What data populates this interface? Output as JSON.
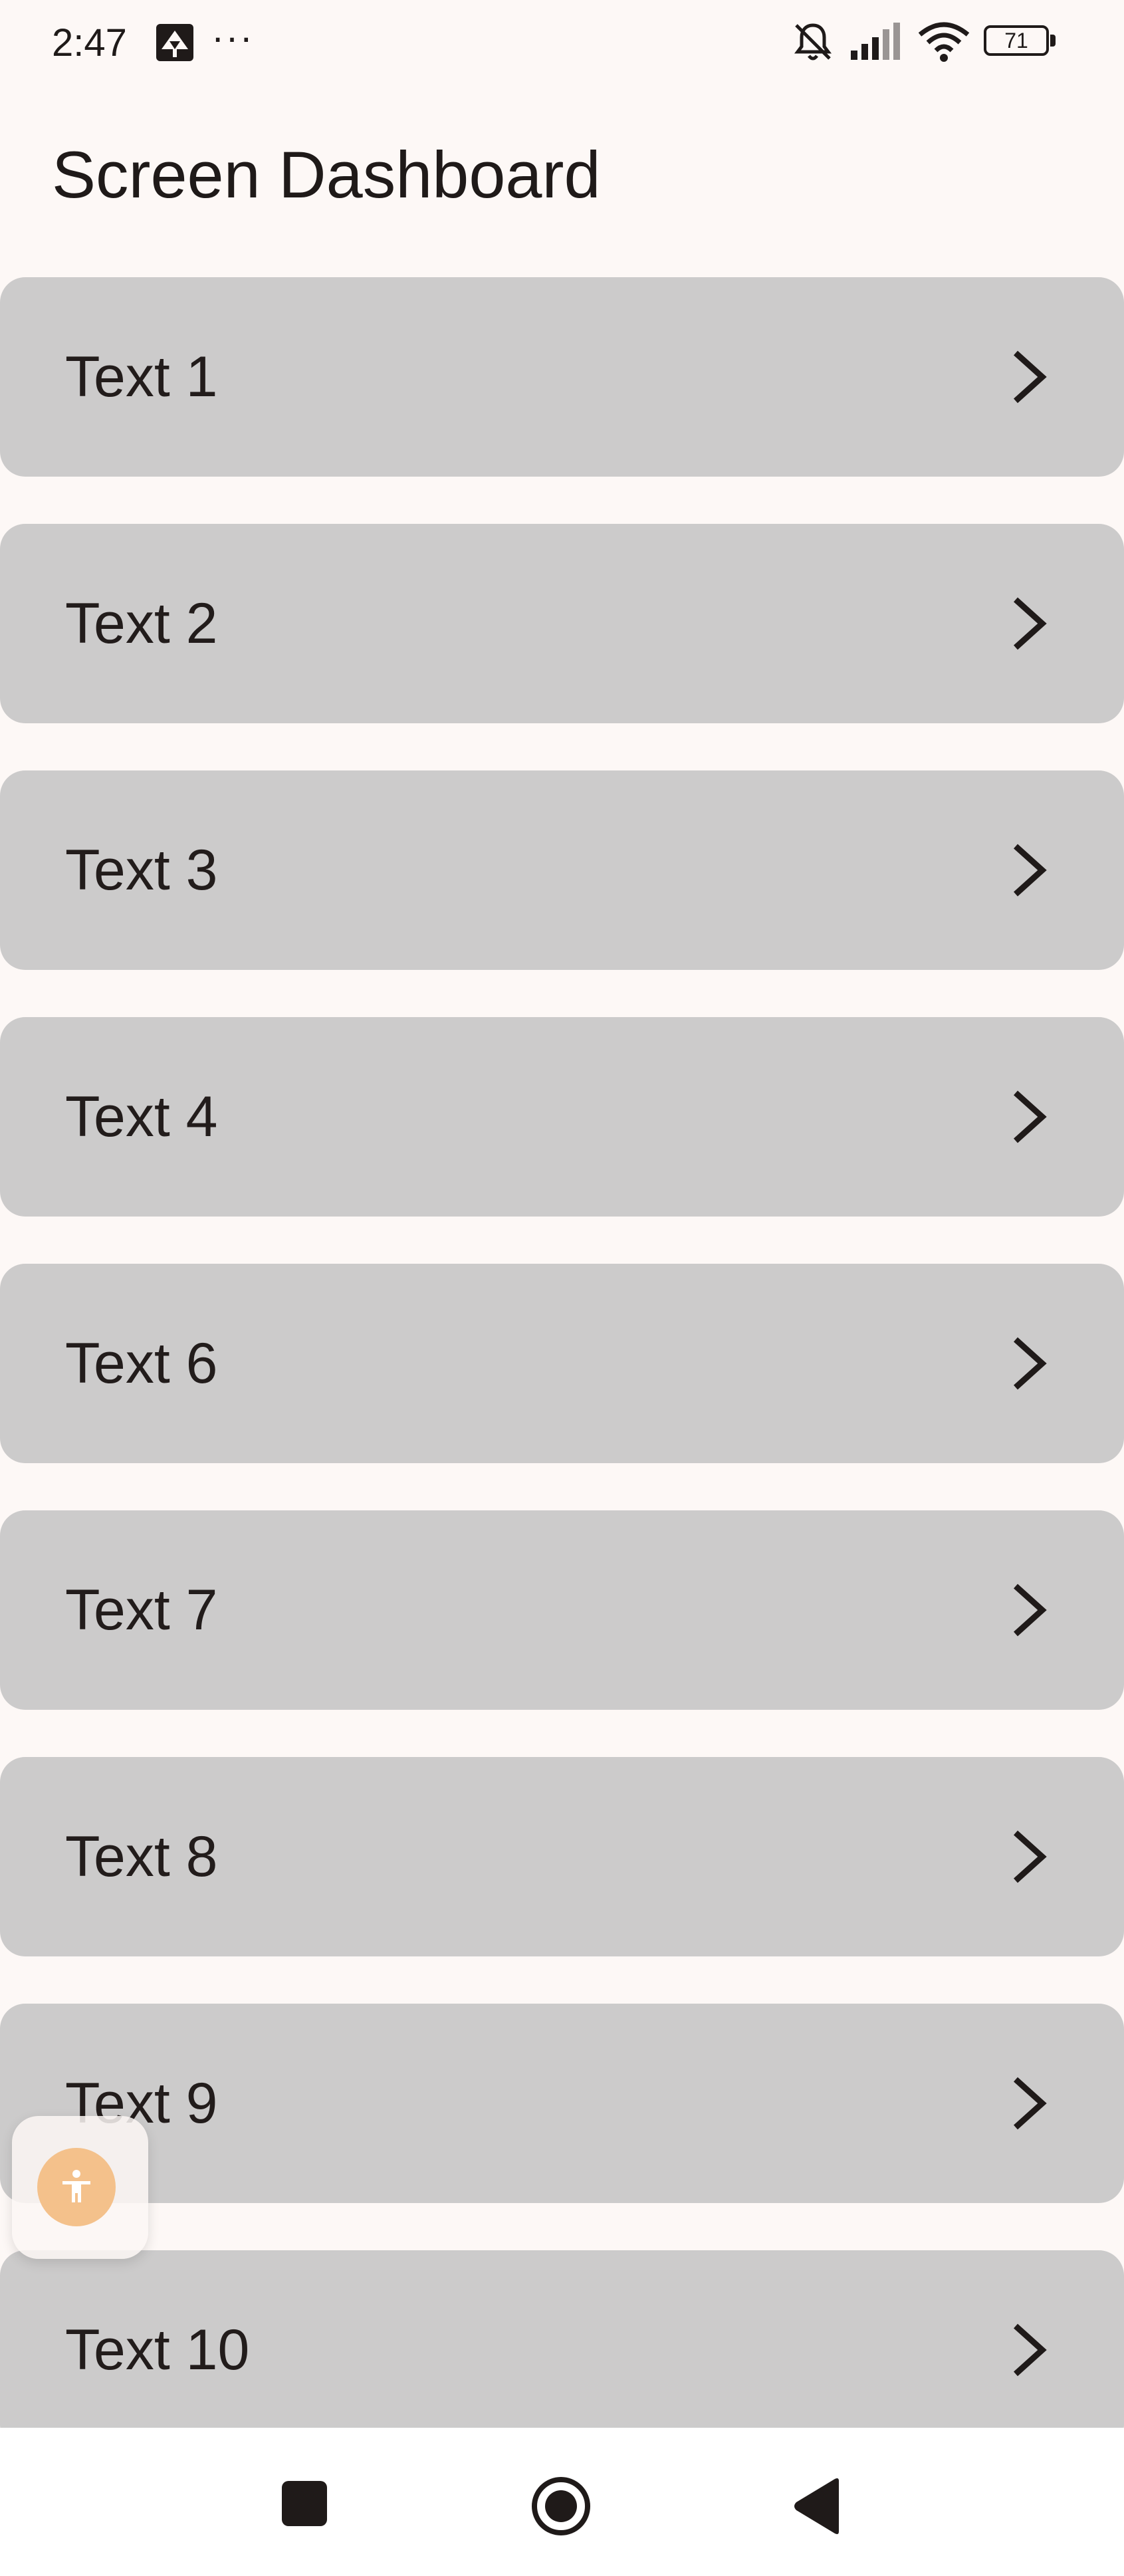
{
  "status_bar": {
    "time": "2:47",
    "more_indicator": "···",
    "battery_level": "71",
    "icons": [
      "app-notification-icon",
      "mute-icon",
      "signal-icon",
      "wifi-icon",
      "battery-icon"
    ]
  },
  "header": {
    "title": "Screen Dashboard"
  },
  "list": {
    "items": [
      {
        "label": "Text 1"
      },
      {
        "label": "Text 2"
      },
      {
        "label": "Text 3"
      },
      {
        "label": "Text 4"
      },
      {
        "label": "Text 6"
      },
      {
        "label": "Text 7"
      },
      {
        "label": "Text 8"
      },
      {
        "label": "Text 9"
      },
      {
        "label": "Text 10"
      }
    ],
    "item_icon": "chevron-right-icon"
  },
  "floating": {
    "icon": "accessibility-icon"
  },
  "nav_bar": {
    "icons": [
      "recents-icon",
      "home-icon",
      "back-icon"
    ]
  },
  "colors": {
    "background": "#fdf8f6",
    "item_background": "#cccbcb",
    "text": "#1f1a19",
    "accessibility_button": "#f4c18b"
  }
}
